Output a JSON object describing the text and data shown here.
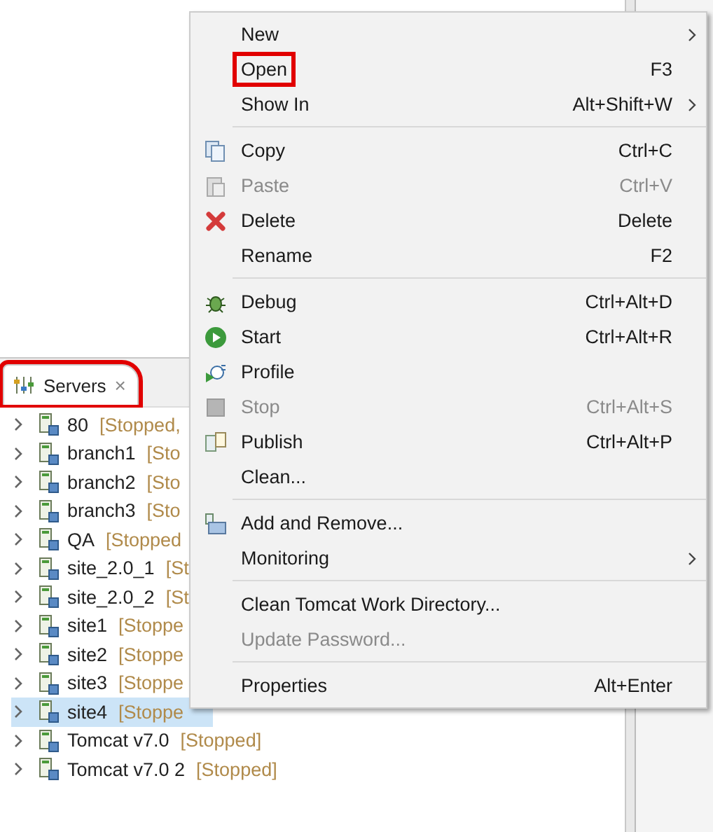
{
  "servers_view": {
    "tab": {
      "label": "Servers",
      "close": "×",
      "selected": true,
      "highlighted": true
    },
    "rows": [
      {
        "name": "80",
        "status": "[Stopped,",
        "selected": false
      },
      {
        "name": "branch1",
        "status": "[Sto",
        "selected": false
      },
      {
        "name": "branch2",
        "status": "[Sto",
        "selected": false
      },
      {
        "name": "branch3",
        "status": "[Sto",
        "selected": false
      },
      {
        "name": "QA",
        "status": "[Stopped",
        "selected": false
      },
      {
        "name": "site_2.0_1",
        "status": "[St",
        "selected": false
      },
      {
        "name": "site_2.0_2",
        "status": "[St",
        "selected": false
      },
      {
        "name": "site1",
        "status": "[Stoppe",
        "selected": false
      },
      {
        "name": "site2",
        "status": "[Stoppe",
        "selected": false
      },
      {
        "name": "site3",
        "status": "[Stoppe",
        "selected": false
      },
      {
        "name": "site4",
        "status": "[Stoppe",
        "selected": true
      },
      {
        "name": "Tomcat v7.0",
        "status": "[Stopped]",
        "selected": false
      },
      {
        "name": "Tomcat v7.0 2",
        "status": "[Stopped]",
        "selected": false
      }
    ]
  },
  "context_menu": {
    "items": [
      {
        "kind": "item",
        "label": "New",
        "submenu": true,
        "disabled": false,
        "highlighted": false
      },
      {
        "kind": "item",
        "label": "Open",
        "shortcut": "F3",
        "disabled": false,
        "highlighted": true
      },
      {
        "kind": "item",
        "label": "Show In",
        "shortcut": "Alt+Shift+W",
        "submenu": true,
        "disabled": false,
        "highlighted": false
      },
      {
        "kind": "separator"
      },
      {
        "kind": "copy",
        "label": "Copy",
        "shortcut": "Ctrl+C",
        "disabled": false,
        "highlighted": false
      },
      {
        "kind": "paste",
        "label": "Paste",
        "shortcut": "Ctrl+V",
        "disabled": true,
        "highlighted": false
      },
      {
        "kind": "delete",
        "label": "Delete",
        "shortcut": "Delete",
        "disabled": false,
        "highlighted": false
      },
      {
        "kind": "item",
        "label": "Rename",
        "shortcut": "F2",
        "disabled": false,
        "highlighted": false
      },
      {
        "kind": "separator"
      },
      {
        "kind": "debug",
        "label": "Debug",
        "shortcut": "Ctrl+Alt+D",
        "disabled": false,
        "highlighted": false
      },
      {
        "kind": "start",
        "label": "Start",
        "shortcut": "Ctrl+Alt+R",
        "disabled": false,
        "highlighted": false
      },
      {
        "kind": "profile",
        "label": "Profile",
        "disabled": false,
        "highlighted": false
      },
      {
        "kind": "stop",
        "label": "Stop",
        "shortcut": "Ctrl+Alt+S",
        "disabled": true,
        "highlighted": false
      },
      {
        "kind": "publish",
        "label": "Publish",
        "shortcut": "Ctrl+Alt+P",
        "disabled": false,
        "highlighted": false
      },
      {
        "kind": "item",
        "label": "Clean...",
        "disabled": false,
        "highlighted": false
      },
      {
        "kind": "separator"
      },
      {
        "kind": "add-remove",
        "label": "Add and Remove...",
        "disabled": false,
        "highlighted": false
      },
      {
        "kind": "item",
        "label": "Monitoring",
        "submenu": true,
        "disabled": false,
        "highlighted": false
      },
      {
        "kind": "separator"
      },
      {
        "kind": "item",
        "label": "Clean Tomcat Work Directory...",
        "disabled": false,
        "highlighted": false
      },
      {
        "kind": "item",
        "label": "Update Password...",
        "disabled": true,
        "highlighted": false
      },
      {
        "kind": "separator"
      },
      {
        "kind": "item",
        "label": "Properties",
        "shortcut": "Alt+Enter",
        "disabled": false,
        "highlighted": false
      }
    ]
  }
}
